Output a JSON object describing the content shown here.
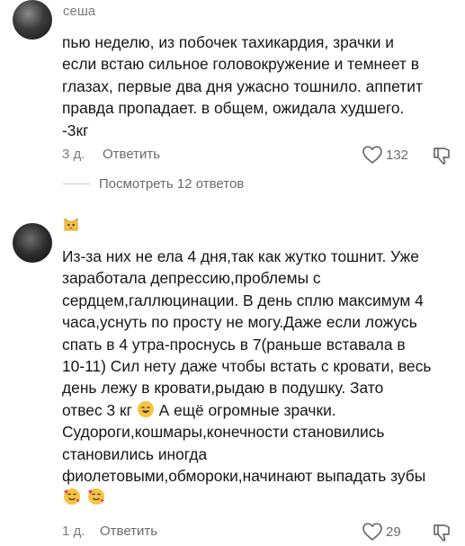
{
  "comments": [
    {
      "username": "сеша",
      "lines": [
        "пью неделю, из побочек тахикардия, зрачки и",
        "если встаю сильное головокружение и темнеет в",
        "глазах, первые два дня ужасно тошнило. аппетит",
        "правда пропадает. в общем, ожидала худшего.",
        "-3кг"
      ],
      "date": "3 д.",
      "reply_label": "Ответить",
      "likes": "132",
      "view_replies": "Посмотреть 12 ответов"
    },
    {
      "username_emoji": "cat-face",
      "lines": [
        "Из-за них не ела 4 дня,так как жутко тошнит. Уже",
        "заработала депрессию,проблемы с",
        "сердцем,галлюцинации. В день сплю максимум 4",
        "часа,уснуть по просту не могу.Даже если ложусь",
        "спать в 4 утра-проснусь в 7(раньше вставала в",
        "10-11) Сил нету даже чтобы встать с кровати, весь",
        "день лежу в кровати,рыдаю в подушку. Зато",
        "отвес 3 кг",
        "А ещё огромные зрачки.",
        "Судороги,кошмары,конечности становились",
        "становились иногда",
        "фиолетовыми,обмороки,начинают выпадать зубы"
      ],
      "date": "1 д.",
      "reply_label": "Ответить",
      "likes": "29"
    }
  ],
  "colors": {
    "text": "#161616",
    "muted": "#7b7b7b",
    "emoji_yellow": "#f6c342"
  }
}
